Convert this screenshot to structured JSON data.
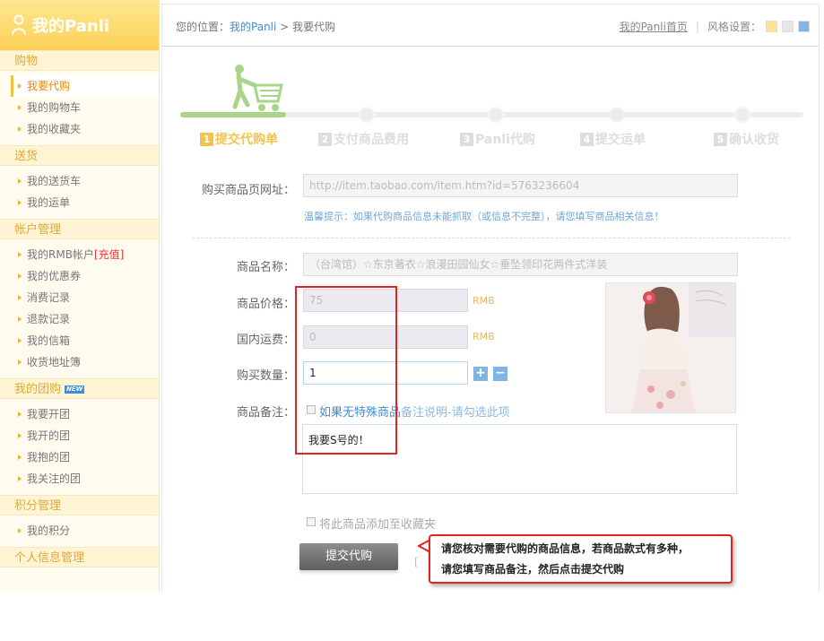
{
  "logo": {
    "text": "我的Panli"
  },
  "sidebar": {
    "sections": [
      {
        "title": "购物",
        "items": [
          "我要代购",
          "我的购物车",
          "我的收藏夹"
        ]
      },
      {
        "title": "送货",
        "items": [
          "我的送货车",
          "我的运单"
        ]
      },
      {
        "title": "帐户管理",
        "items": [
          "我的RMB帐户",
          "我的优惠券",
          "消费记录",
          "退款记录",
          "我的信箱",
          "收货地址簿"
        ],
        "recharge": "[充值]"
      },
      {
        "title": "我的团购",
        "badge": "NEW",
        "items": [
          "我要开团",
          "我开的团",
          "我抱的团",
          "我关注的团"
        ]
      },
      {
        "title": "积分管理",
        "items": [
          "我的积分"
        ]
      },
      {
        "title": "个人信息管理",
        "items": []
      }
    ]
  },
  "header": {
    "crumb_prefix": "您的位置：",
    "crumb_link": "我的Panli",
    "crumb_sep": " > ",
    "crumb_current": "我要代购",
    "home_link": "我的Panli首页",
    "style_label": "风格设置：",
    "swatches": [
      "#ffe38f",
      "#e6e6e6",
      "#7fb6e6"
    ]
  },
  "steps": [
    {
      "num": "1",
      "label": "提交代购单"
    },
    {
      "num": "2",
      "label": "支付商品费用"
    },
    {
      "num": "3",
      "label": "Panli代购"
    },
    {
      "num": "4",
      "label": "提交运单"
    },
    {
      "num": "5",
      "label": "确认收货"
    }
  ],
  "form": {
    "url_label": "购买商品页网址：",
    "url_value": "http://item.taobao.com/item.htm?id=5763236604",
    "tip": "温馨提示：如果代购商品信息未能抓取（或信息不完整），请您填写商品相关信息！",
    "name_label": "商品名称：",
    "name_value": "（台湾馆）☆东京著衣☆浪漫田园仙女☆垂坠领印花两件式洋装",
    "price_label": "商品价格：",
    "price_value": "75",
    "price_unit": "RMB",
    "shipping_label": "国内运费：",
    "shipping_value": "0",
    "shipping_unit": "RMB",
    "qty_label": "购买数量：",
    "qty_value": "1",
    "qty_plus": "+",
    "qty_minus": "−",
    "remark_label": "商品备注：",
    "remark_check_link": "如果无特殊商品",
    "remark_check_hint": "备注说明-请勾选此项",
    "remark_text": "我要S号的！",
    "fav_label": "将此商品添加至收藏夹",
    "submit": "提交代购",
    "bracket": "["
  },
  "tooltip": {
    "line1": "请您核对需要代购的商品信息，若商品款式有多种，",
    "line2": "请您填写商品备注，然后点击提交代购"
  },
  "colors": {
    "accent": "#f4c34a",
    "link": "#3b8ed7",
    "alert": "#e32222"
  }
}
